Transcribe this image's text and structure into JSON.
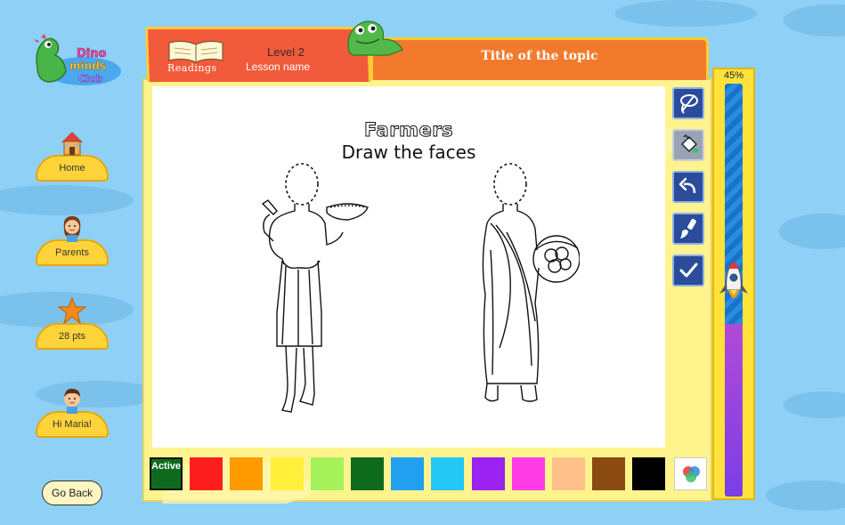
{
  "logo": {
    "text_line1": "Dino",
    "text_line2": "minds",
    "text_line3": "Club"
  },
  "sidebar": {
    "items": [
      {
        "label": "Home",
        "icon": "house-icon"
      },
      {
        "label": "Parents",
        "icon": "parent-avatar-icon"
      },
      {
        "label": "28 pts",
        "icon": "star-icon"
      },
      {
        "label": "Hi Maria!",
        "icon": "child-avatar-icon"
      }
    ],
    "go_back": "Go Back"
  },
  "header": {
    "readings_label": "Readings",
    "level": "Level 2",
    "lesson": "Lesson name",
    "topic": "Title of the topic"
  },
  "canvas": {
    "title": "Farmers",
    "subtitle": "Draw the faces"
  },
  "tools": [
    {
      "icon": "lasso-icon"
    },
    {
      "icon": "paint-bucket-icon"
    },
    {
      "icon": "undo-icon"
    },
    {
      "icon": "brush-icon"
    },
    {
      "icon": "check-icon"
    }
  ],
  "progress": {
    "label": "45%",
    "value": 0.45
  },
  "palette": {
    "active_label": "Active",
    "colors": [
      "#0e6b1e",
      "#ff1e1e",
      "#ff9a00",
      "#ffee3a",
      "#a6f25a",
      "#0e6b1e",
      "#21a0f0",
      "#23c8f5",
      "#9b22f0",
      "#ff3ce6",
      "#ffc08a",
      "#8a4a12",
      "#000000"
    ],
    "mixer_icon": "color-mixer-icon"
  },
  "colors": {
    "sky": "#8fd0f6",
    "frame": "#fff38e",
    "tab_red": "#f25a3c",
    "tab_orange": "#f27a2c",
    "gold": "#ffd43b"
  }
}
